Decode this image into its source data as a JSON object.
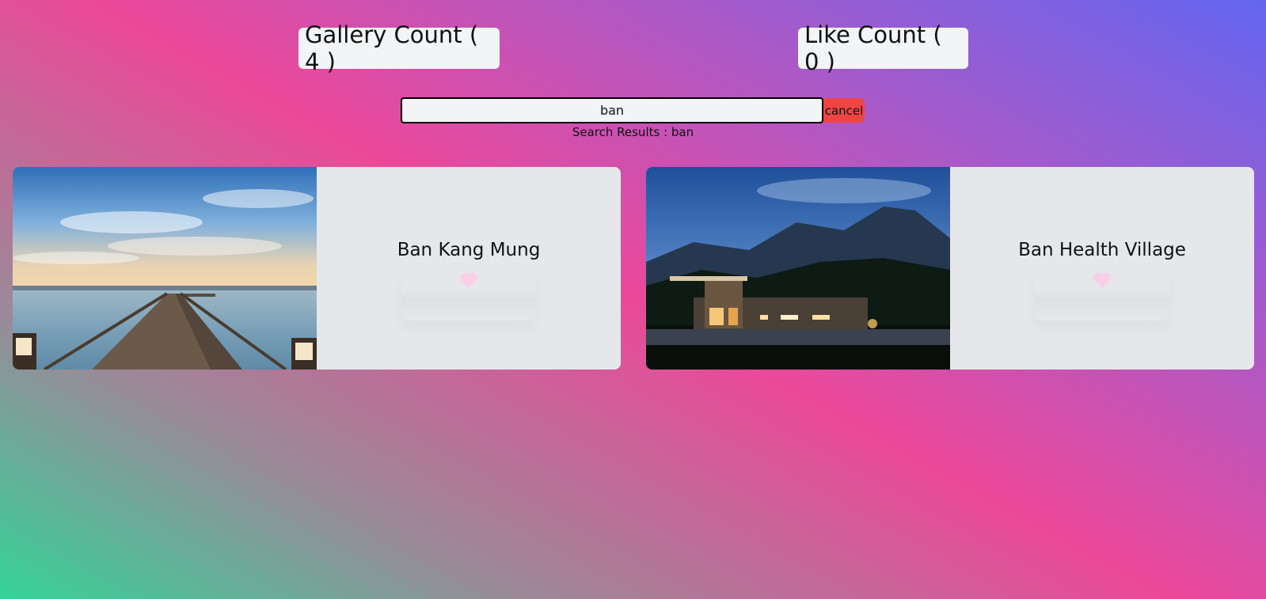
{
  "counters": {
    "gallery": "Gallery Count ( 4 )",
    "likes": "Like Count ( 0 )"
  },
  "search": {
    "value": "ban",
    "cancel_label": "cancel",
    "results_label": "Search Results : ",
    "results_query": "ban"
  },
  "cards": [
    {
      "title": "Ban Kang Mung",
      "liked": false
    },
    {
      "title": "Ban Health Village",
      "liked": false
    }
  ],
  "colors": {
    "heart": "#fbcfe8",
    "cancel": "#ef4444",
    "card_bg": "#e5e7eb"
  }
}
